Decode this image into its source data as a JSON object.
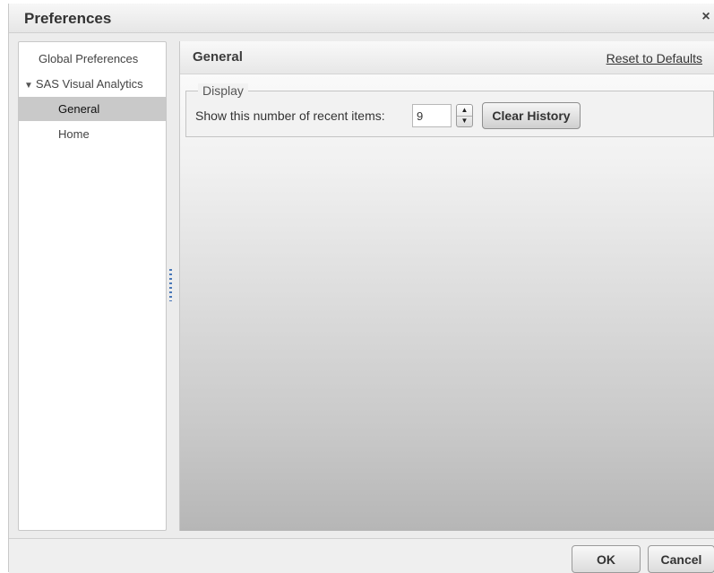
{
  "dialog": {
    "title": "Preferences",
    "close_icon": "×"
  },
  "nav": {
    "items": [
      {
        "label": "Global Preferences"
      },
      {
        "label": "SAS Visual Analytics",
        "expander": "▼"
      },
      {
        "label": "General",
        "selected": true
      },
      {
        "label": "Home"
      }
    ]
  },
  "content": {
    "title": "General",
    "reset_label": "Reset to Defaults",
    "display_group": {
      "legend": "Display",
      "recent_label": "Show this number of recent items:",
      "recent_value": "9",
      "spin_up": "▲",
      "spin_down": "▼",
      "clear_label": "Clear History"
    }
  },
  "footer": {
    "ok_label": "OK",
    "cancel_label": "Cancel"
  },
  "colors": {
    "selected_item_bg": "#c9c9c9",
    "splitter": "#4a78b8"
  }
}
